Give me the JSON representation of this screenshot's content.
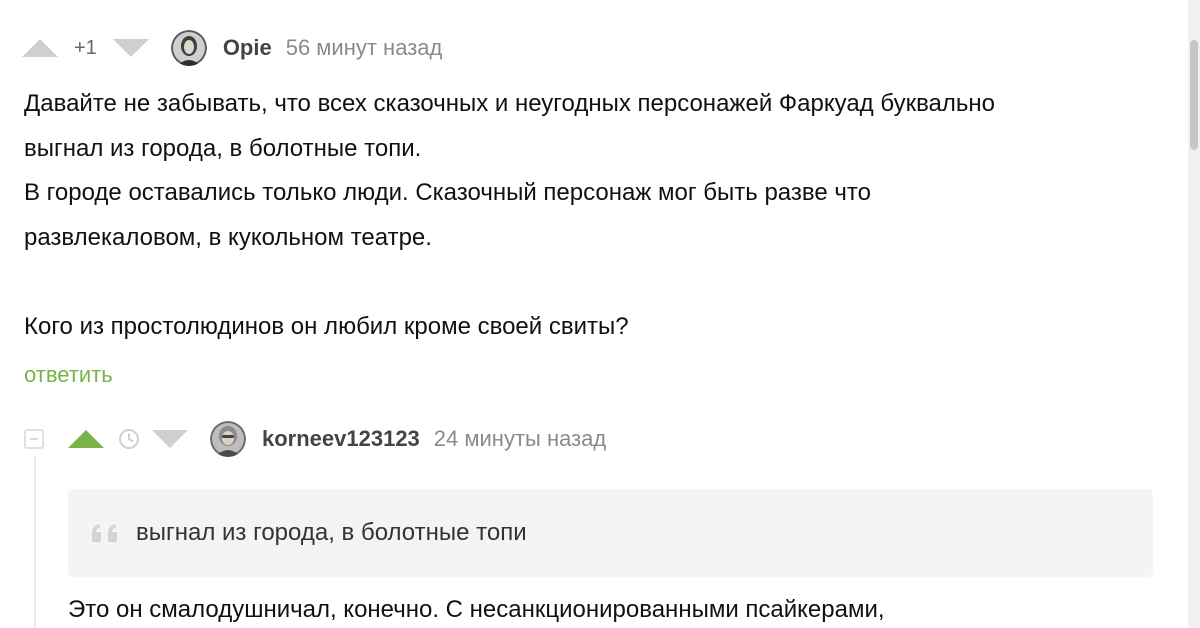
{
  "comment1": {
    "rating": "+1",
    "author": "Opie",
    "time": "56 минут назад",
    "lines": [
      "Давайте не забывать, что всех сказочных и неугодных персонажей Фаркуад буквально",
      "выгнал из города, в болотные топи.",
      "В городе оставались только люди. Сказочный персонаж мог быть разве что",
      "развлекаловом, в кукольном театре.",
      "Кого из простолюдинов он любил кроме своей свиты?"
    ],
    "reply_label": "ответить"
  },
  "comment2": {
    "author": "korneev123123",
    "time": "24 минуты назад",
    "quote": "выгнал из города, в болотные топи",
    "body": "Это он смалодушничал, конечно. С несанкционированными псайкерами,"
  },
  "colors": {
    "accent": "#7bb24b",
    "vote_inactive": "#cfcfcf",
    "quote_bg": "#f4f4f4",
    "muted_text": "#8a8a8a"
  },
  "icons": {
    "upvote": "triangle-up",
    "downvote": "triangle-down",
    "pending": "clock",
    "quote": "double-quote",
    "collapse": "minus-square"
  }
}
